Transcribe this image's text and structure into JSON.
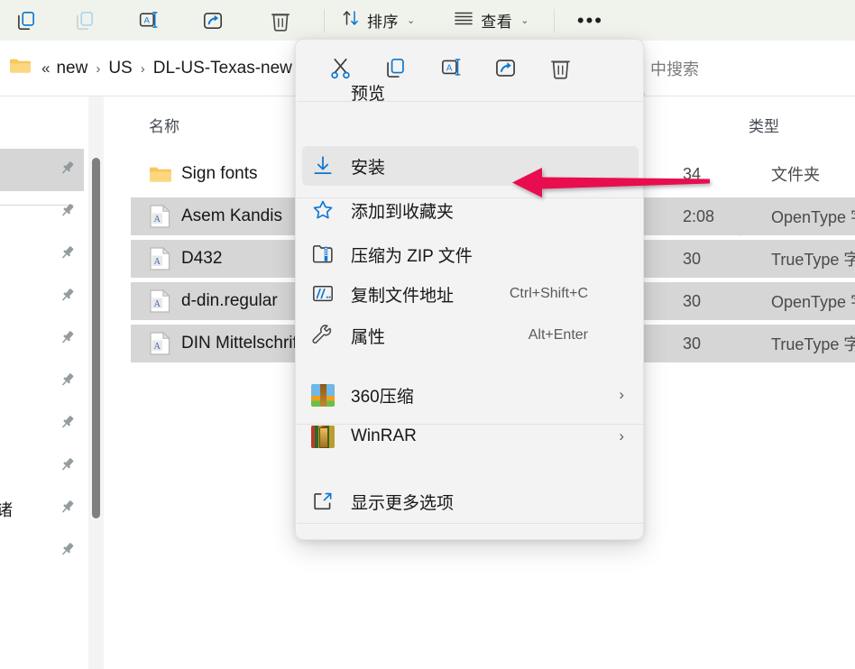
{
  "toolbar": {
    "buttons": [
      {
        "name": "copy-icon",
        "label": "复制"
      },
      {
        "name": "paste-icon",
        "label": "粘贴"
      },
      {
        "name": "rename-icon",
        "label": "重命名"
      },
      {
        "name": "share-icon",
        "label": "共享"
      },
      {
        "name": "delete-icon",
        "label": "删除"
      }
    ],
    "sort_label": "排序",
    "view_label": "查看",
    "more_label": "•••"
  },
  "address": {
    "double_chevron": "«",
    "segments": [
      "new",
      "US",
      "DL-US-Texas-new"
    ],
    "separator": "›",
    "search_text": "中搜索"
  },
  "columns": {
    "name": "名称",
    "type": "类型"
  },
  "files": [
    {
      "name": "Sign fonts",
      "icon": "folder-icon",
      "date": "34",
      "type": "文件夹",
      "selected": false
    },
    {
      "name": "Asem Kandis",
      "icon": "font-file-icon",
      "date": "2:08",
      "type": "OpenType 字",
      "selected": true
    },
    {
      "name": "D432",
      "icon": "font-file-icon",
      "date": "30",
      "type": "TrueType 字体",
      "selected": true
    },
    {
      "name": "d-din.regular",
      "icon": "font-file-icon",
      "date": "30",
      "type": "OpenType 字",
      "selected": true
    },
    {
      "name": "DIN Mittelschrift",
      "icon": "font-file-icon",
      "date": "30",
      "type": "TrueType 字体",
      "selected": true
    }
  ],
  "nav": {
    "pin_label": "固定",
    "partial_label": "诸",
    "rows": [
      {
        "pinned": true,
        "selected": true,
        "label": ""
      },
      {
        "pinned": true,
        "selected": false,
        "label": ""
      },
      {
        "pinned": true,
        "selected": false,
        "label": ""
      },
      {
        "pinned": true,
        "selected": false,
        "label": ""
      },
      {
        "pinned": true,
        "selected": false,
        "label": ""
      },
      {
        "pinned": true,
        "selected": false,
        "label": ""
      },
      {
        "pinned": true,
        "selected": false,
        "label": ""
      },
      {
        "pinned": true,
        "selected": false,
        "label": ""
      },
      {
        "pinned": true,
        "selected": false,
        "label": "诸"
      },
      {
        "pinned": true,
        "selected": false,
        "label": ""
      }
    ]
  },
  "context_menu": {
    "icon_row": [
      {
        "name": "cut-icon",
        "label": "剪切"
      },
      {
        "name": "copy-icon",
        "label": "复制"
      },
      {
        "name": "rename-icon",
        "label": "重命名"
      },
      {
        "name": "share-icon",
        "label": "共享"
      },
      {
        "name": "delete-icon",
        "label": "删除"
      }
    ],
    "items": [
      {
        "label": "预览",
        "icon": "",
        "accel": "",
        "submenu": false,
        "highlighted": false
      },
      {
        "label": "安装",
        "icon": "install-icon",
        "accel": "",
        "submenu": false,
        "highlighted": true
      },
      {
        "label": "添加到收藏夹",
        "icon": "star-icon",
        "accel": "",
        "submenu": false,
        "highlighted": false
      },
      {
        "label": "压缩为 ZIP 文件",
        "icon": "zip-icon",
        "accel": "",
        "submenu": false,
        "highlighted": false
      },
      {
        "label": "复制文件地址",
        "icon": "copy-path-icon",
        "accel": "Ctrl+Shift+C",
        "submenu": false,
        "highlighted": false
      },
      {
        "label": "属性",
        "icon": "wrench-icon",
        "accel": "Alt+Enter",
        "submenu": false,
        "highlighted": false
      },
      {
        "label": "360压缩",
        "icon": "app-360zip-icon",
        "accel": "",
        "submenu": true,
        "highlighted": false
      },
      {
        "label": "WinRAR",
        "icon": "app-winrar-icon",
        "accel": "",
        "submenu": true,
        "highlighted": false
      },
      {
        "label": "显示更多选项",
        "icon": "more-options-icon",
        "accel": "",
        "submenu": false,
        "highlighted": false
      }
    ],
    "submenu_chevron": "›"
  },
  "annotation": {
    "arrow_color": "#e8104f",
    "points_to": "安装"
  },
  "colors": {
    "toolbar_bg": "#f0f3ec",
    "menu_bg": "#f3f3f3",
    "highlight": "#e6e6e6",
    "row_selected": "#d6d6d6",
    "accent_blue": "#0b76d0",
    "arrow": "#e8104f"
  }
}
